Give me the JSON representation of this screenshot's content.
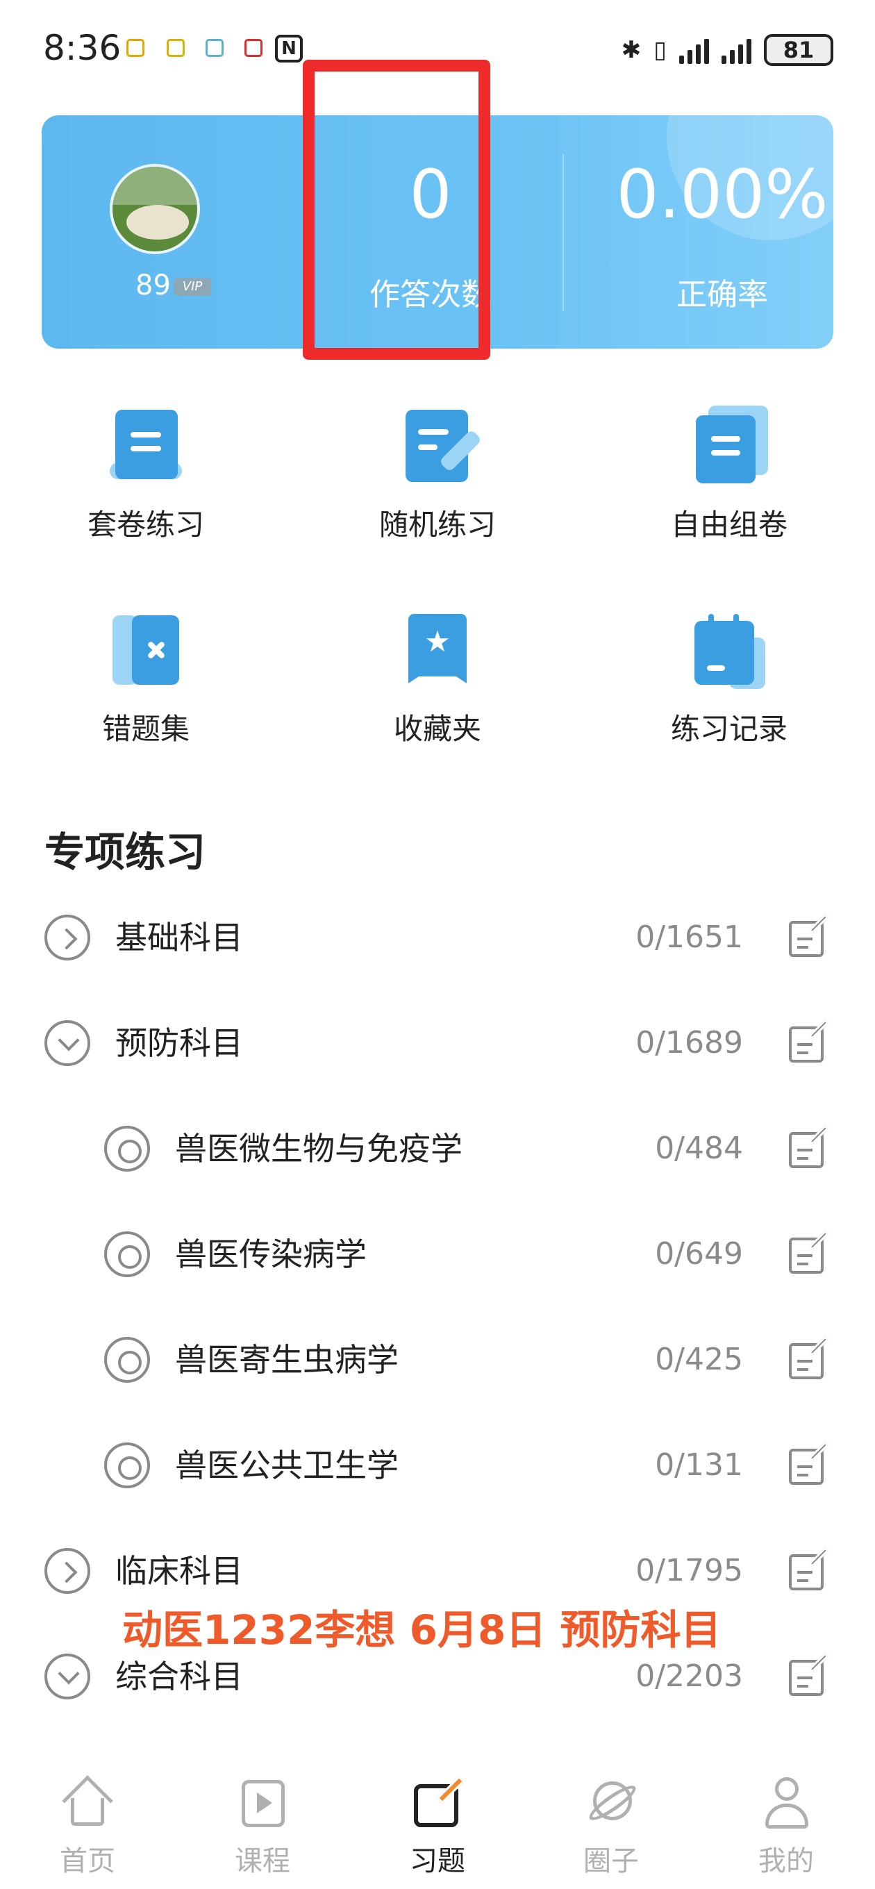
{
  "status_bar": {
    "time": "8:36",
    "nfc_label": "N",
    "battery": "81"
  },
  "stats": {
    "user_number": "89",
    "vip_label": "VIP",
    "answer_count": "0",
    "answer_count_label": "作答次数",
    "accuracy": "0.00%",
    "accuracy_label": "正确率"
  },
  "tools": [
    {
      "label": "套卷练习",
      "icon": "scroll-doc-icon"
    },
    {
      "label": "随机练习",
      "icon": "edit-doc-icon"
    },
    {
      "label": "自由组卷",
      "icon": "stacked-doc-icon"
    },
    {
      "label": "错题集",
      "icon": "wrong-notebook-icon"
    },
    {
      "label": "收藏夹",
      "icon": "bookmark-star-icon"
    },
    {
      "label": "练习记录",
      "icon": "calendar-record-icon"
    }
  ],
  "section": {
    "title": "专项练习",
    "rows": [
      {
        "name": "基础科目",
        "count": "0/1651",
        "state": "collapsed",
        "level": 0
      },
      {
        "name": "预防科目",
        "count": "0/1689",
        "state": "expanded",
        "level": 0
      },
      {
        "name": "兽医微生物与免疫学",
        "count": "0/484",
        "state": "leaf",
        "level": 1
      },
      {
        "name": "兽医传染病学",
        "count": "0/649",
        "state": "leaf",
        "level": 1
      },
      {
        "name": "兽医寄生虫病学",
        "count": "0/425",
        "state": "leaf",
        "level": 1
      },
      {
        "name": "兽医公共卫生学",
        "count": "0/131",
        "state": "leaf",
        "level": 1
      },
      {
        "name": "临床科目",
        "count": "0/1795",
        "state": "collapsed",
        "level": 0
      },
      {
        "name": "综合科目",
        "count": "0/2203",
        "state": "expanded",
        "level": 0
      }
    ]
  },
  "overlay_note": "动医1232李想 6月8日 预防科目",
  "bottom_nav": [
    {
      "label": "首页",
      "icon": "home-icon",
      "active": false
    },
    {
      "label": "课程",
      "icon": "course-play-icon",
      "active": false
    },
    {
      "label": "习题",
      "icon": "exercise-edit-icon",
      "active": true
    },
    {
      "label": "圈子",
      "icon": "planet-icon",
      "active": false
    },
    {
      "label": "我的",
      "icon": "profile-icon",
      "active": false
    }
  ],
  "colors": {
    "accent_blue": "#3a9ee0",
    "card_blue": "#5db8f0",
    "highlight_red": "#ee2a2a",
    "overlay_orange": "#ef5a2a"
  }
}
